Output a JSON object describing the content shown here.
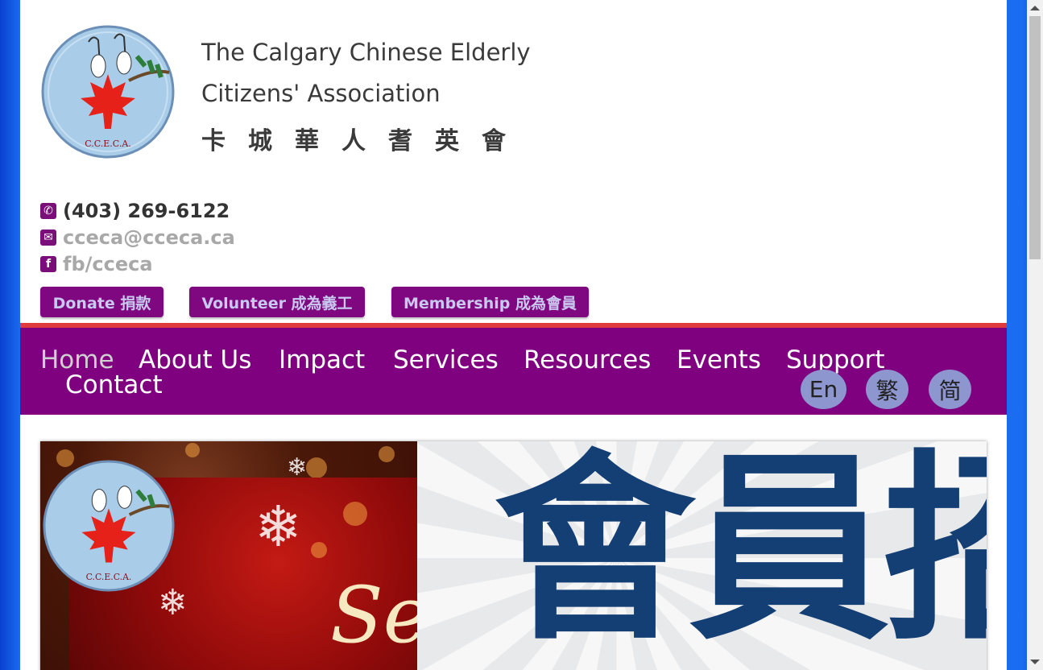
{
  "header": {
    "title_line1": "The Calgary Chinese Elderly",
    "title_line2": "Citizens' Association",
    "title_cn": "卡城華人耆英會",
    "logo_text": "C.C.E.C.A."
  },
  "contact": {
    "phone": "(403) 269-6122",
    "email": "cceca@cceca.ca",
    "facebook": "fb/cceca"
  },
  "cta": {
    "donate": "Donate 捐款",
    "volunteer": "Volunteer 成為義工",
    "membership": "Membership 成為會員"
  },
  "nav": {
    "items": [
      "Home",
      "About Us",
      "Impact",
      "Services",
      "Resources",
      "Events",
      "Support",
      "Contact"
    ],
    "active": "Home"
  },
  "lang": {
    "en": "En",
    "traditional": "繁",
    "simplified": "简"
  },
  "slide": {
    "left_script": "Se",
    "right_text": "會員招募",
    "logo_text": "C.C.E.C.A."
  },
  "colors": {
    "brand_purple": "#7f017f",
    "accent_red": "#e0393e",
    "lang_button": "#8d96cf"
  }
}
